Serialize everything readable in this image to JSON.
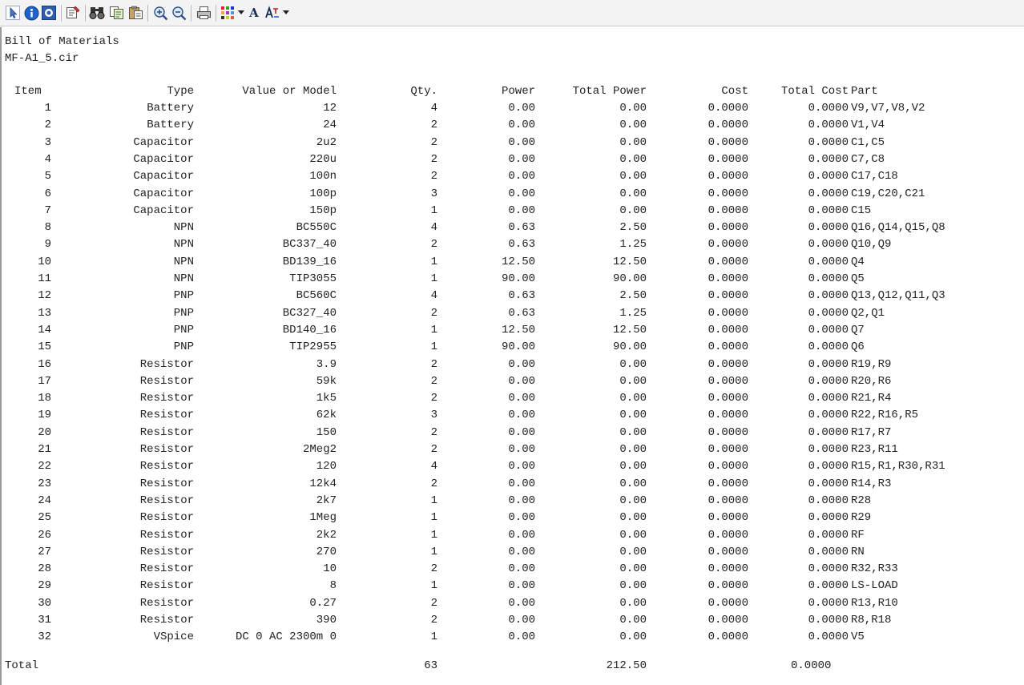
{
  "report": {
    "title": "Bill of Materials",
    "filename": "MF-A1_5.cir"
  },
  "toolbar": {
    "icons": [
      "pointer-icon",
      "info-icon",
      "help-icon",
      "properties-icon",
      "find-icon",
      "copy-icon",
      "paste-icon",
      "zoom-in-icon",
      "zoom-out-icon",
      "print-icon",
      "color-grid-icon",
      "dropdown-arrow-icon",
      "font-icon",
      "text-format-icon",
      "dropdown-arrow-icon"
    ],
    "colors": {
      "info_blue": "#1f63c8",
      "help_blue": "#2d5fae"
    },
    "font_label": "A"
  },
  "table": {
    "headers": {
      "item": "Item",
      "type": "Type",
      "value": "Value or Model",
      "qty": "Qty.",
      "power": "Power",
      "total_power": "Total Power",
      "cost": "Cost",
      "total_cost": "Total Cost",
      "part": "Part"
    },
    "rows": [
      [
        "1",
        "Battery",
        "12",
        "4",
        "0.00",
        "0.00",
        "0.0000",
        "0.0000",
        "V9,V7,V8,V2"
      ],
      [
        "2",
        "Battery",
        "24",
        "2",
        "0.00",
        "0.00",
        "0.0000",
        "0.0000",
        "V1,V4"
      ],
      [
        "3",
        "Capacitor",
        "2u2",
        "2",
        "0.00",
        "0.00",
        "0.0000",
        "0.0000",
        "C1,C5"
      ],
      [
        "4",
        "Capacitor",
        "220u",
        "2",
        "0.00",
        "0.00",
        "0.0000",
        "0.0000",
        "C7,C8"
      ],
      [
        "5",
        "Capacitor",
        "100n",
        "2",
        "0.00",
        "0.00",
        "0.0000",
        "0.0000",
        "C17,C18"
      ],
      [
        "6",
        "Capacitor",
        "100p",
        "3",
        "0.00",
        "0.00",
        "0.0000",
        "0.0000",
        "C19,C20,C21"
      ],
      [
        "7",
        "Capacitor",
        "150p",
        "1",
        "0.00",
        "0.00",
        "0.0000",
        "0.0000",
        "C15"
      ],
      [
        "8",
        "NPN",
        "BC550C",
        "4",
        "0.63",
        "2.50",
        "0.0000",
        "0.0000",
        "Q16,Q14,Q15,Q8"
      ],
      [
        "9",
        "NPN",
        "BC337_40",
        "2",
        "0.63",
        "1.25",
        "0.0000",
        "0.0000",
        "Q10,Q9"
      ],
      [
        "10",
        "NPN",
        "BD139_16",
        "1",
        "12.50",
        "12.50",
        "0.0000",
        "0.0000",
        "Q4"
      ],
      [
        "11",
        "NPN",
        "TIP3055",
        "1",
        "90.00",
        "90.00",
        "0.0000",
        "0.0000",
        "Q5"
      ],
      [
        "12",
        "PNP",
        "BC560C",
        "4",
        "0.63",
        "2.50",
        "0.0000",
        "0.0000",
        "Q13,Q12,Q11,Q3"
      ],
      [
        "13",
        "PNP",
        "BC327_40",
        "2",
        "0.63",
        "1.25",
        "0.0000",
        "0.0000",
        "Q2,Q1"
      ],
      [
        "14",
        "PNP",
        "BD140_16",
        "1",
        "12.50",
        "12.50",
        "0.0000",
        "0.0000",
        "Q7"
      ],
      [
        "15",
        "PNP",
        "TIP2955",
        "1",
        "90.00",
        "90.00",
        "0.0000",
        "0.0000",
        "Q6"
      ],
      [
        "16",
        "Resistor",
        "3.9",
        "2",
        "0.00",
        "0.00",
        "0.0000",
        "0.0000",
        "R19,R9"
      ],
      [
        "17",
        "Resistor",
        "59k",
        "2",
        "0.00",
        "0.00",
        "0.0000",
        "0.0000",
        "R20,R6"
      ],
      [
        "18",
        "Resistor",
        "1k5",
        "2",
        "0.00",
        "0.00",
        "0.0000",
        "0.0000",
        "R21,R4"
      ],
      [
        "19",
        "Resistor",
        "62k",
        "3",
        "0.00",
        "0.00",
        "0.0000",
        "0.0000",
        "R22,R16,R5"
      ],
      [
        "20",
        "Resistor",
        "150",
        "2",
        "0.00",
        "0.00",
        "0.0000",
        "0.0000",
        "R17,R7"
      ],
      [
        "21",
        "Resistor",
        "2Meg2",
        "2",
        "0.00",
        "0.00",
        "0.0000",
        "0.0000",
        "R23,R11"
      ],
      [
        "22",
        "Resistor",
        "120",
        "4",
        "0.00",
        "0.00",
        "0.0000",
        "0.0000",
        "R15,R1,R30,R31"
      ],
      [
        "23",
        "Resistor",
        "12k4",
        "2",
        "0.00",
        "0.00",
        "0.0000",
        "0.0000",
        "R14,R3"
      ],
      [
        "24",
        "Resistor",
        "2k7",
        "1",
        "0.00",
        "0.00",
        "0.0000",
        "0.0000",
        "R28"
      ],
      [
        "25",
        "Resistor",
        "1Meg",
        "1",
        "0.00",
        "0.00",
        "0.0000",
        "0.0000",
        "R29"
      ],
      [
        "26",
        "Resistor",
        "2k2",
        "1",
        "0.00",
        "0.00",
        "0.0000",
        "0.0000",
        "RF"
      ],
      [
        "27",
        "Resistor",
        "270",
        "1",
        "0.00",
        "0.00",
        "0.0000",
        "0.0000",
        "RN"
      ],
      [
        "28",
        "Resistor",
        "10",
        "2",
        "0.00",
        "0.00",
        "0.0000",
        "0.0000",
        "R32,R33"
      ],
      [
        "29",
        "Resistor",
        "8",
        "1",
        "0.00",
        "0.00",
        "0.0000",
        "0.0000",
        "LS-LOAD"
      ],
      [
        "30",
        "Resistor",
        "0.27",
        "2",
        "0.00",
        "0.00",
        "0.0000",
        "0.0000",
        "R13,R10"
      ],
      [
        "31",
        "Resistor",
        "390",
        "2",
        "0.00",
        "0.00",
        "0.0000",
        "0.0000",
        "R8,R18"
      ],
      [
        "32",
        "VSpice",
        "DC 0 AC 2300m 0",
        "1",
        "0.00",
        "0.00",
        "0.0000",
        "0.0000",
        "V5"
      ]
    ],
    "total": {
      "label": "Total",
      "qty": "63",
      "total_power": "212.50",
      "total_cost": "0.0000"
    }
  }
}
